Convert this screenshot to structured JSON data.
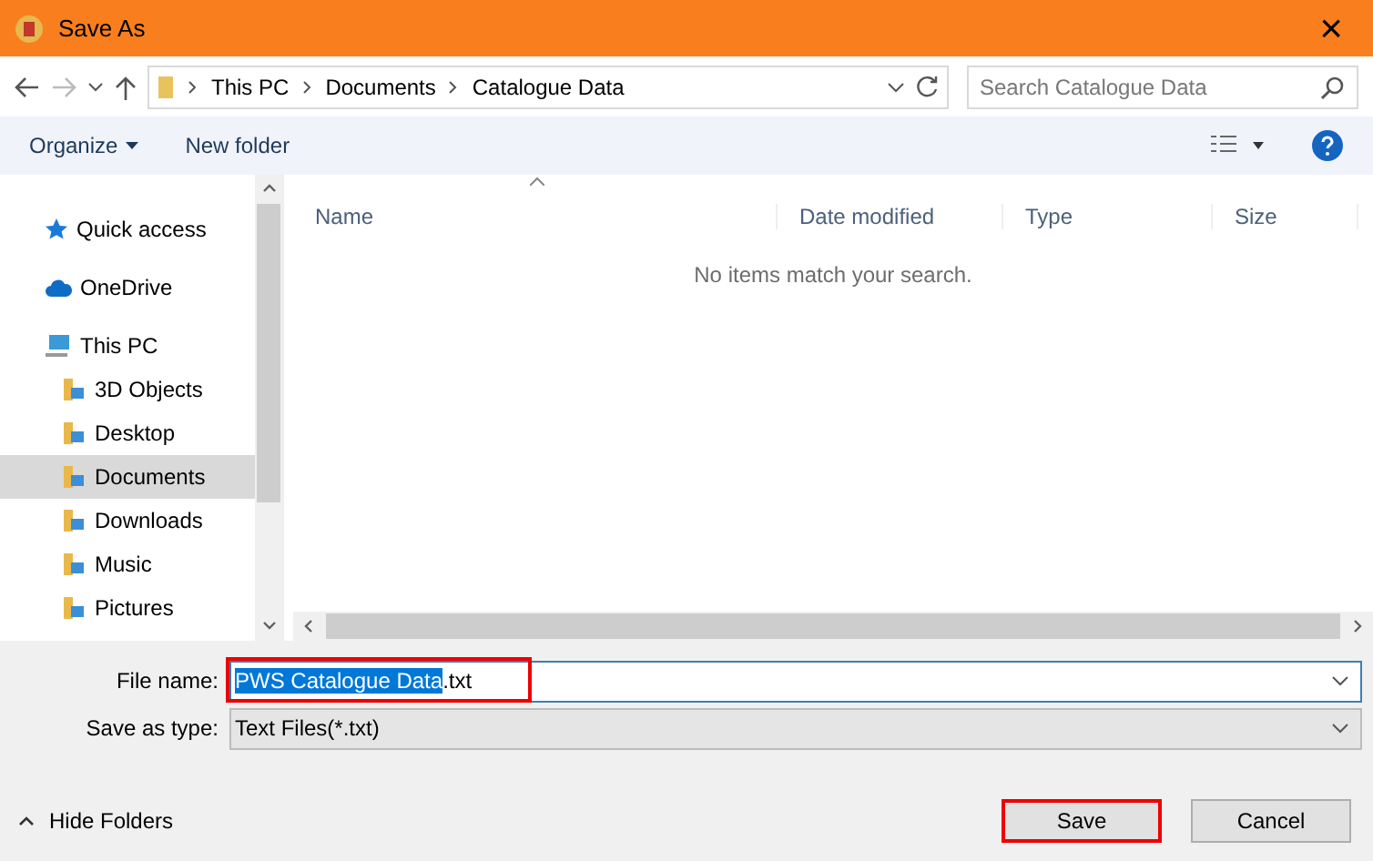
{
  "window": {
    "title": "Save As",
    "close": "×"
  },
  "address": {
    "path": [
      "This PC",
      "Documents",
      "Catalogue Data"
    ],
    "search_placeholder": "Search Catalogue Data"
  },
  "toolbar": {
    "organize": "Organize",
    "new_folder": "New folder"
  },
  "sidebar": {
    "items": [
      {
        "label": "Quick access",
        "kind": "star",
        "selected": false
      },
      {
        "label": "OneDrive",
        "kind": "cloud",
        "selected": false
      },
      {
        "label": "This PC",
        "kind": "pc",
        "selected": false,
        "children": [
          {
            "label": "3D Objects",
            "kind": "folder",
            "selected": false
          },
          {
            "label": "Desktop",
            "kind": "folder",
            "selected": false
          },
          {
            "label": "Documents",
            "kind": "folder",
            "selected": true
          },
          {
            "label": "Downloads",
            "kind": "folder",
            "selected": false
          },
          {
            "label": "Music",
            "kind": "folder",
            "selected": false
          },
          {
            "label": "Pictures",
            "kind": "folder",
            "selected": false
          }
        ]
      }
    ]
  },
  "table": {
    "columns": [
      "Name",
      "Date modified",
      "Type",
      "Size"
    ],
    "empty_message": "No items match your search."
  },
  "form": {
    "file_name_label": "File name:",
    "file_name_selected": "PWS Catalogue Data",
    "file_name_rest": ".txt",
    "file_name_highlighted": true,
    "type_label": "Save as type:",
    "type_value": "Text Files(*.txt)"
  },
  "footer": {
    "hide_folders": "Hide Folders",
    "buttons": [
      {
        "label": "Save",
        "highlighted": true
      },
      {
        "label": "Cancel",
        "highlighted": false
      }
    ]
  }
}
